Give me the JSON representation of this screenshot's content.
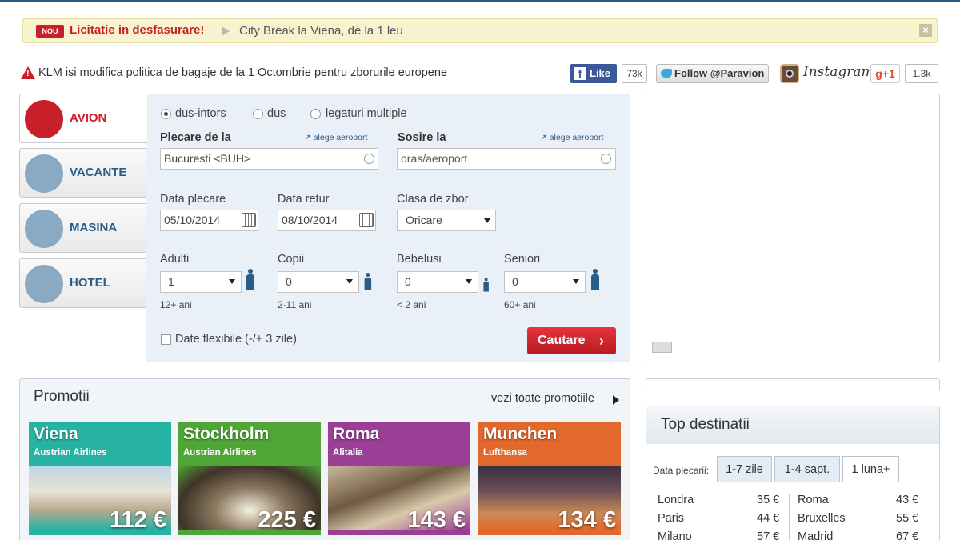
{
  "notice": {
    "badge": "NOU",
    "auction": "Licitatie in desfasurare!",
    "offer": "City Break la Viena, de la 1 leu",
    "close": "×"
  },
  "alert": {
    "text": "KLM isi modifica politica de bagaje de la 1 Octombrie pentru zborurile europene"
  },
  "social": {
    "fb_like": "Like",
    "fb_count": "73k",
    "twitter": "Follow @Paravion",
    "instagram": "Instagram",
    "gplus": "g+1",
    "gplus_count": "1.3k"
  },
  "tabs": [
    {
      "label": "AVION"
    },
    {
      "label": "VACANTE"
    },
    {
      "label": "MASINA"
    },
    {
      "label": "HOTEL"
    }
  ],
  "form": {
    "trip": {
      "roundtrip": "dus-intors",
      "oneway": "dus",
      "multi": "legaturi multiple"
    },
    "from_label": "Plecare de la",
    "to_label": "Sosire la",
    "choose_airport": "alege aeroport",
    "from_value": "Bucuresti <BUH>",
    "to_placeholder": "oras/aeroport",
    "depart_label": "Data plecare",
    "return_label": "Data retur",
    "class_label": "Clasa de zbor",
    "depart_value": "05/10/2014",
    "return_value": "08/10/2014",
    "class_value": "Oricare",
    "adults_label": "Adulti",
    "children_label": "Copii",
    "infants_label": "Bebelusi",
    "seniors_label": "Seniori",
    "adults_value": "1",
    "children_value": "0",
    "infants_value": "0",
    "seniors_value": "0",
    "adults_age": "12+ ani",
    "children_age": "2-11 ani",
    "infants_age": "< 2 ani",
    "seniors_age": "60+ ani",
    "flexible": "Date flexibile (-/+ 3 zile)",
    "search": "Cautare"
  },
  "promotions": {
    "title": "Promotii",
    "see_all": "vezi toate promotiile",
    "cards": [
      {
        "city": "Viena",
        "airline": "Austrian Airlines",
        "price": "112 €",
        "color": "#27b3a4"
      },
      {
        "city": "Stockholm",
        "airline": "Austrian Airlines",
        "price": "225 €",
        "color": "#4fa636"
      },
      {
        "city": "Roma",
        "airline": "Alitalia",
        "price": "143 €",
        "color": "#9b3f96"
      },
      {
        "city": "Munchen",
        "airline": "Lufthansa",
        "price": "134 €",
        "color": "#e2692b"
      }
    ]
  },
  "top": {
    "title": "Top destinatii",
    "date_label": "Data plecarii:",
    "tabs": [
      "1-7 zile",
      "1-4 sapt.",
      "1 luna+"
    ],
    "left": [
      {
        "city": "Londra",
        "price": "35 €"
      },
      {
        "city": "Paris",
        "price": "44 €"
      },
      {
        "city": "Milano",
        "price": "57 €"
      }
    ],
    "right": [
      {
        "city": "Roma",
        "price": "43 €"
      },
      {
        "city": "Bruxelles",
        "price": "55 €"
      },
      {
        "city": "Madrid",
        "price": "67 €"
      }
    ]
  }
}
